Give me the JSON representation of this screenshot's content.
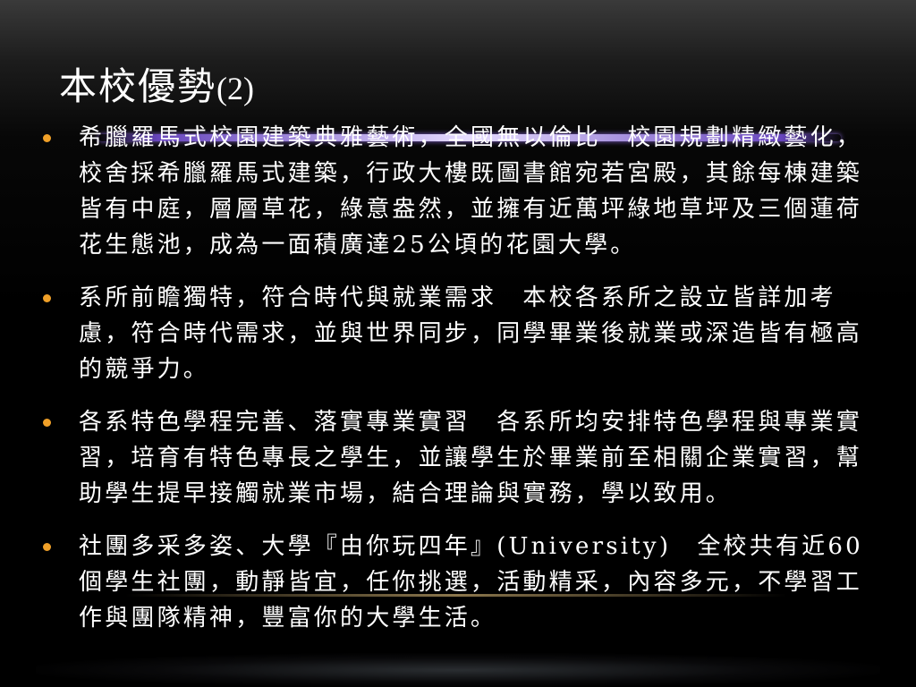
{
  "slide": {
    "title": "本校優勢",
    "title_suffix": "(2)",
    "bullets": [
      {
        "text": "希臘羅馬式校園建築典雅藝術，全國無以倫比　校園規劃精緻藝化，校舍採希臘羅馬式建築，行政大樓既圖書館宛若宮殿，其餘每棟建築皆有中庭，層層草花，綠意盎然，並擁有近萬坪綠地草坪及三個蓮荷花生態池，成為一面積廣達25公頃的花園大學。"
      },
      {
        "text": "系所前瞻獨特，符合時代與就業需求　本校各系所之設立皆詳加考慮，符合時代需求，並與世界同步，同學畢業後就業或深造皆有極高的競爭力。"
      },
      {
        "text": "各系特色學程完善、落實專業實習　各系所均安排特色學程與專業實習，培育有特色專長之學生，並讓學生於畢業前至相關企業實習，幫助學生提早接觸就業市場，結合理論與實務，學以致用。"
      },
      {
        "text": "社團多采多姿、大學『由你玩四年』(University)　全校共有近60個學生社團，動靜皆宜，任你挑選，活動精采，內容多元，不學習工作與團隊精神，豐富你的大學生活。"
      }
    ],
    "colors": {
      "bullet": "#f0a028",
      "text": "#ffffff",
      "background": "#000000"
    }
  }
}
